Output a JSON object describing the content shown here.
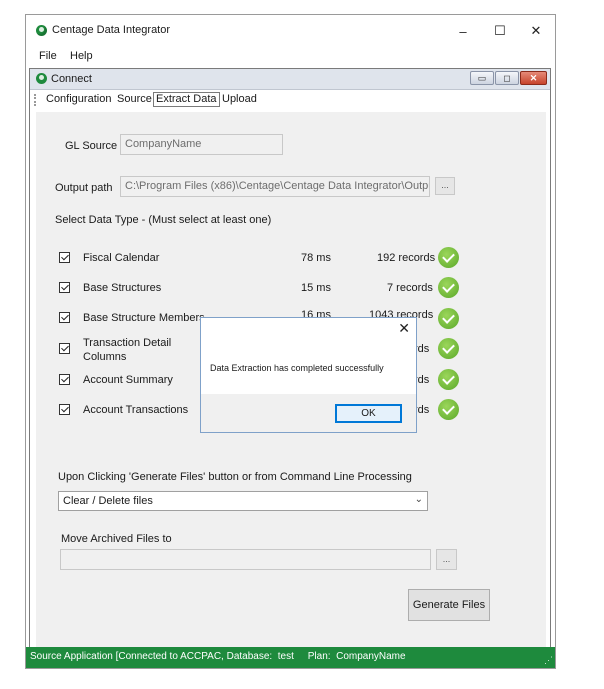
{
  "window": {
    "title": "Centage Data Integrator",
    "minimize_glyph": "–",
    "maximize_glyph": "☐",
    "close_glyph": "✕"
  },
  "menu": {
    "items": [
      "File",
      "Help"
    ]
  },
  "child_window": {
    "title": "Connect",
    "tabs": [
      "Configuration",
      "Source",
      "Extract Data",
      "Upload"
    ],
    "active_tab": "Extract Data"
  },
  "form": {
    "gl_source_label": "GL Source",
    "gl_source_value": "CompanyName",
    "output_path_label": "Output path",
    "output_path_value": "C:\\Program Files (x86)\\Centage\\Centage Data Integrator\\Output",
    "browse_label": "...",
    "select_type_label": "Select Data Type - (Must select at least one)"
  },
  "data_types": [
    {
      "label": "Fiscal Calendar",
      "time": "78 ms",
      "records": "192 records"
    },
    {
      "label": "Base Structures",
      "time": "15 ms",
      "records": "7 records"
    },
    {
      "label": "Base Structure Members",
      "time": "16 ms",
      "records": "1043 records"
    },
    {
      "label": "Transaction Detail\nColumns",
      "time": "",
      "records": "rds"
    },
    {
      "label": "Account Summary",
      "time": "",
      "records": "rds"
    },
    {
      "label": "Account Transactions",
      "time": "",
      "records": "rds"
    }
  ],
  "processing": {
    "label": "Upon Clicking 'Generate Files' button or from Command Line Processing",
    "selected_option": "Clear / Delete files",
    "archive_label": "Move Archived Files to",
    "archive_value": "",
    "browse_label": "...",
    "generate_button": "Generate Files"
  },
  "status_bar": {
    "text": "Source Application [Connected to ACCPAC, Database:  test     Plan:  CompanyName"
  },
  "dialog": {
    "message": "Data Extraction has completed successfully",
    "ok_label": "OK",
    "close_glyph": "✕"
  },
  "colors": {
    "status_bar": "#1e8a3d",
    "success_icon": "#6dbb35",
    "panel_bg": "#f0f0f0",
    "dialog_border": "#7fa1c9"
  },
  "icons": {
    "app": "app-logo-icon",
    "success": "check-circle-icon",
    "checkbox": "checkbox-checked-icon"
  }
}
